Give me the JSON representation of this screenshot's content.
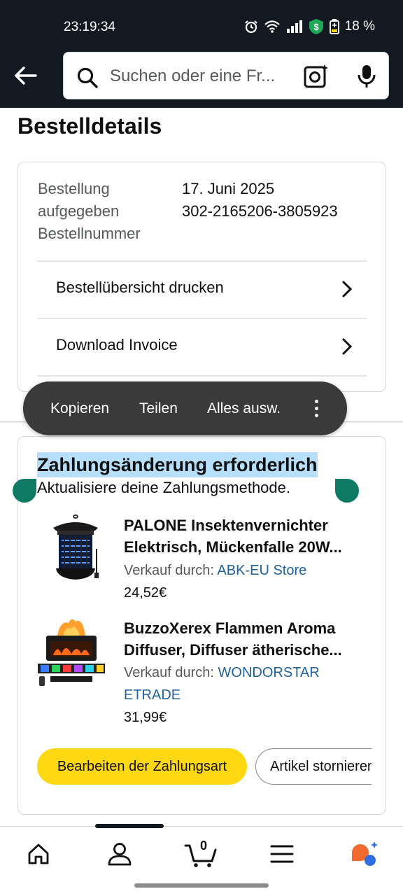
{
  "status_bar": {
    "time": "23:19:34",
    "battery": "18 %",
    "icons": [
      "alarm-icon",
      "wifi-icon",
      "signal-icon",
      "shield-dollar-icon",
      "battery-icon"
    ]
  },
  "header": {
    "search_placeholder": "Suchen oder eine Fr...",
    "icons": [
      "back-arrow-icon",
      "search-icon",
      "camera-icon",
      "microphone-icon"
    ]
  },
  "page": {
    "title": "Bestelldetails"
  },
  "order": {
    "placed_label_1": "Bestellung",
    "placed_label_2": "aufgegeben",
    "number_label": "Bestellnummer",
    "date": "17. Juni 2025",
    "number": "302-2165206-3805923",
    "links": [
      {
        "label": "Bestellübersicht drucken"
      },
      {
        "label": "Download Invoice"
      }
    ]
  },
  "context_menu": {
    "items": [
      "Kopieren",
      "Teilen",
      "Alles ausw."
    ]
  },
  "payment": {
    "title": "Zahlungsänderung erforderlich",
    "subtitle": "Aktualisiere deine Zahlungsmethode.",
    "items": [
      {
        "title": "PALONE Insektenvernichter Elektrisch, Mückenfalle 20W...",
        "sold_by_label": "Verkauf durch:",
        "seller": "ABK-EU Store",
        "price": "24,52€"
      },
      {
        "title": "BuzzoXerex Flammen Aroma Diffuser, Diffuser ätherische...",
        "sold_by_label": "Verkauf durch:",
        "seller": "WONDORSTAR ETRADE",
        "price": "31,99€"
      }
    ],
    "primary_button": "Bearbeiten der Zahlungsart",
    "secondary_button": "Artikel stornieren"
  },
  "bottom_nav": {
    "cart_count": "0",
    "items": [
      "home-icon",
      "account-icon",
      "cart-icon",
      "menu-icon",
      "ai-assistant-icon"
    ]
  },
  "colors": {
    "header_bg": "#131921",
    "primary_button": "#ffd814",
    "link": "#2162a1",
    "selection": "#b7dffb",
    "selection_handle": "#0f7a64"
  }
}
